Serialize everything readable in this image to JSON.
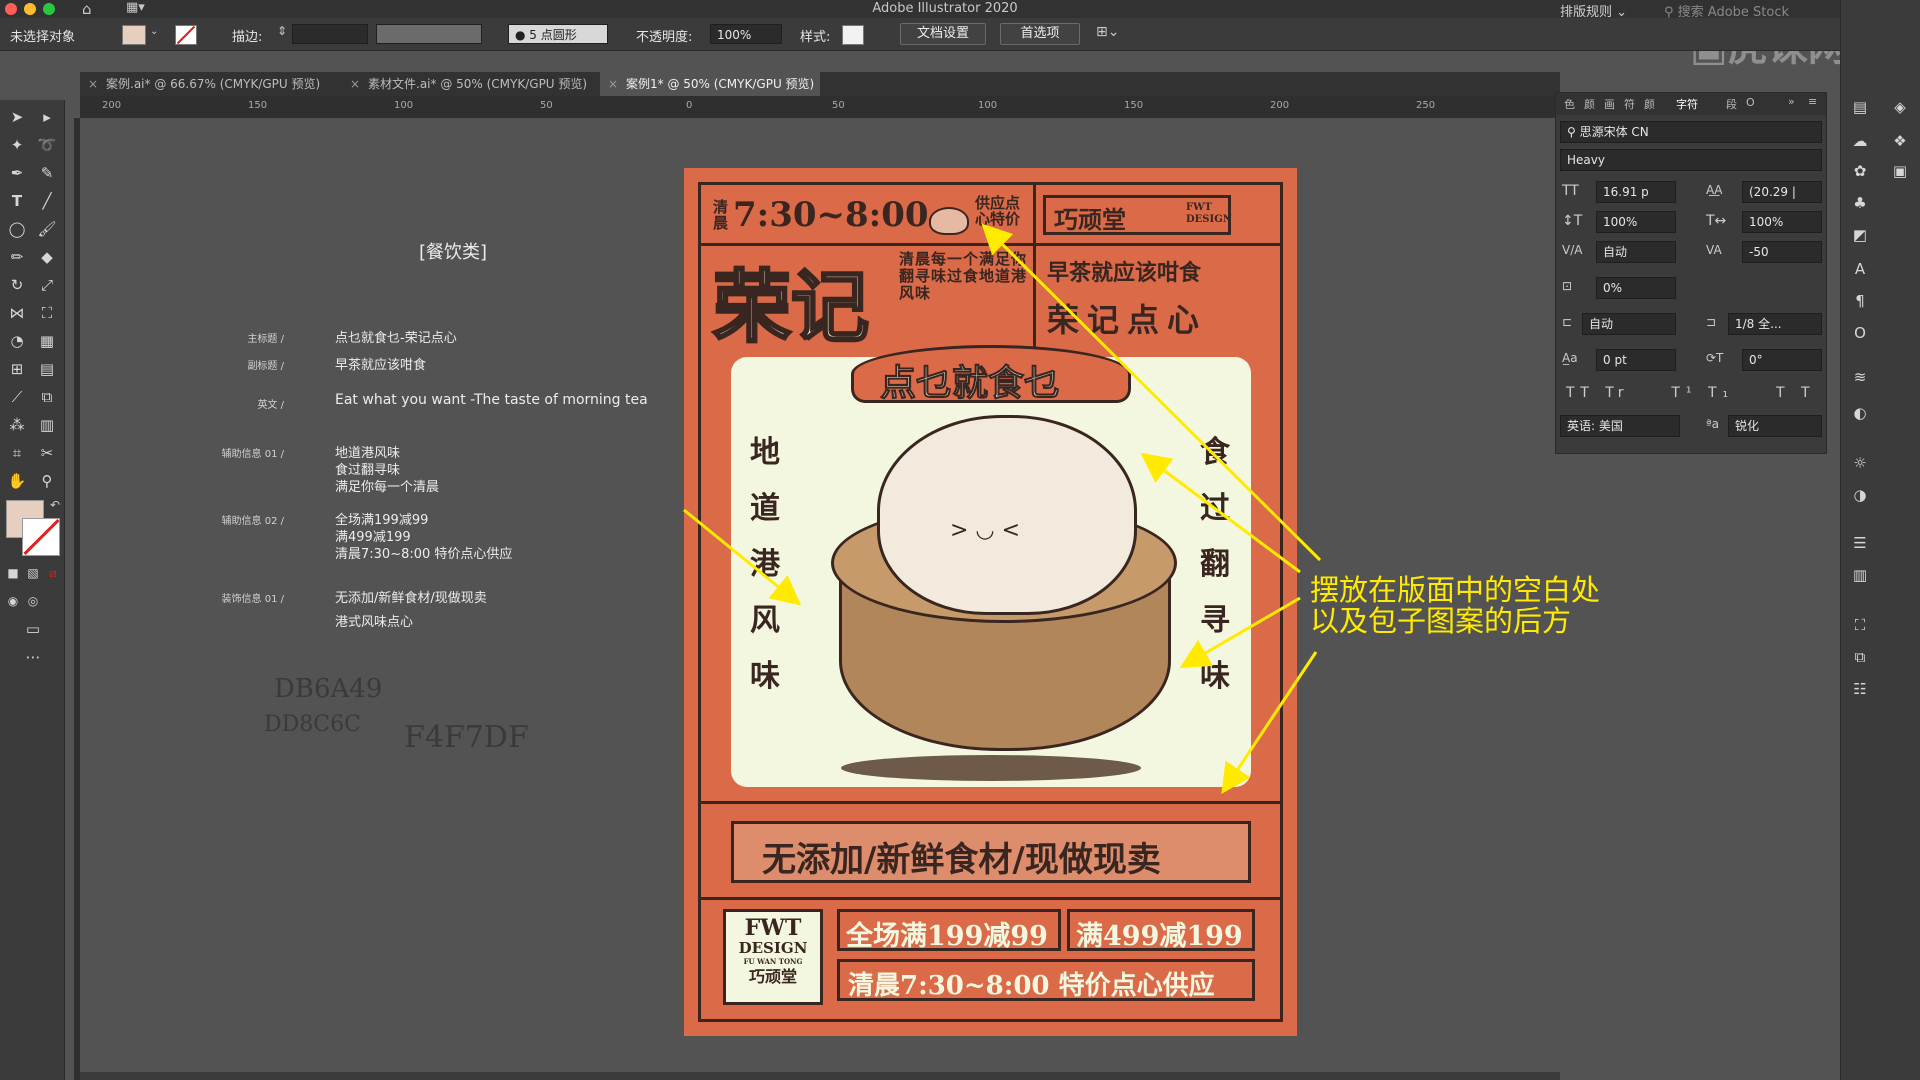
{
  "window": {
    "title": "Adobe Illustrator 2020",
    "workspace": "排版规则",
    "search_placeholder": "搜索 Adobe Stock",
    "watermark": "虎课网"
  },
  "control_bar": {
    "selection": "未选择对象",
    "stroke_label": "描边:",
    "brush": "5 点圆形",
    "opacity_label": "不透明度:",
    "opacity_value": "100%",
    "style_label": "样式:",
    "doc_setup": "文档设置",
    "preferences": "首选项"
  },
  "tabs": [
    {
      "label": "案例.ai* @ 66.67% (CMYK/GPU 预览)"
    },
    {
      "label": "素材文件.ai* @ 50% (CMYK/GPU 预览)"
    },
    {
      "label": "案例1* @ 50% (CMYK/GPU 预览)"
    }
  ],
  "ruler": [
    "200",
    "150",
    "100",
    "50",
    "0",
    "50",
    "100",
    "150",
    "200",
    "250"
  ],
  "notes": {
    "category": "[餐饮类]",
    "rows": [
      {
        "label": "主标题 /",
        "lines": [
          "点乜就食乜-荣记点心"
        ]
      },
      {
        "label": "副标题 /",
        "lines": [
          "早茶就应该咁食"
        ]
      },
      {
        "label": "英文 /",
        "lines": [
          "Eat what you want -The taste of morning tea"
        ]
      },
      {
        "label": "辅助信息 01 /",
        "lines": [
          "地道港风味",
          "食过翻寻味",
          "满足你每一个清晨"
        ]
      },
      {
        "label": "辅助信息 02 /",
        "lines": [
          "全场满199减99",
          "满499减199",
          "清晨7:30~8:00 特价点心供应"
        ]
      },
      {
        "label": "装饰信息 01 /",
        "lines": [
          "无添加/新鲜食材/现做现卖",
          "港式风味点心"
        ]
      }
    ],
    "colors": [
      "DB6A49",
      "DD8C6C",
      "F4F7DF"
    ]
  },
  "poster": {
    "time_prefix": "清晨",
    "time": "7:30~8:00",
    "special": "供应点心特价",
    "logo": "巧顽堂",
    "logo_tag": "FWT DESIGN",
    "brand": "荣记",
    "poem": "清晨每一个满足你翻寻味过食地道港风味",
    "tagline": "早茶就应该咁食",
    "shop": "荣记点心",
    "title": "点乜就食乜",
    "left_chars": [
      "地",
      "道",
      "港",
      "风",
      "味"
    ],
    "right_chars": [
      "食",
      "过",
      "翻",
      "寻",
      "味"
    ],
    "banner": "无添加/新鲜食材/现做现卖",
    "promo1": "全场满199减99",
    "promo2": "满499减199",
    "promo3": "清晨7:30~8:00 特价点心供应",
    "footer_logo": [
      "FWT",
      "DESIGN",
      "FU WAN TONG",
      "巧顽堂"
    ]
  },
  "callout": [
    "摆放在版面中的空白处",
    "以及包子图案的后方"
  ],
  "character_panel": {
    "tabs": [
      "色",
      "颜",
      "画",
      "符",
      "颜",
      "字符",
      "段",
      "O"
    ],
    "font_family": "思源宋体 CN",
    "font_style": "Heavy",
    "font_size": "16.91 p",
    "leading": "(20.29 |",
    "vscale": "100%",
    "hscale": "100%",
    "kerning": "自动",
    "tracking": "-50",
    "tsume": "0%",
    "aki_left": "自动",
    "aki_right": "1/8 全...",
    "baseline": "0 pt",
    "rotation": "0°",
    "language": "英语: 美国",
    "antialias": "锐化"
  },
  "colors": {
    "poster_orange": "#DB6A49",
    "poster_light": "#DD8C6C",
    "poster_cream": "#F4F7DF",
    "callout": "#FFEA00"
  }
}
